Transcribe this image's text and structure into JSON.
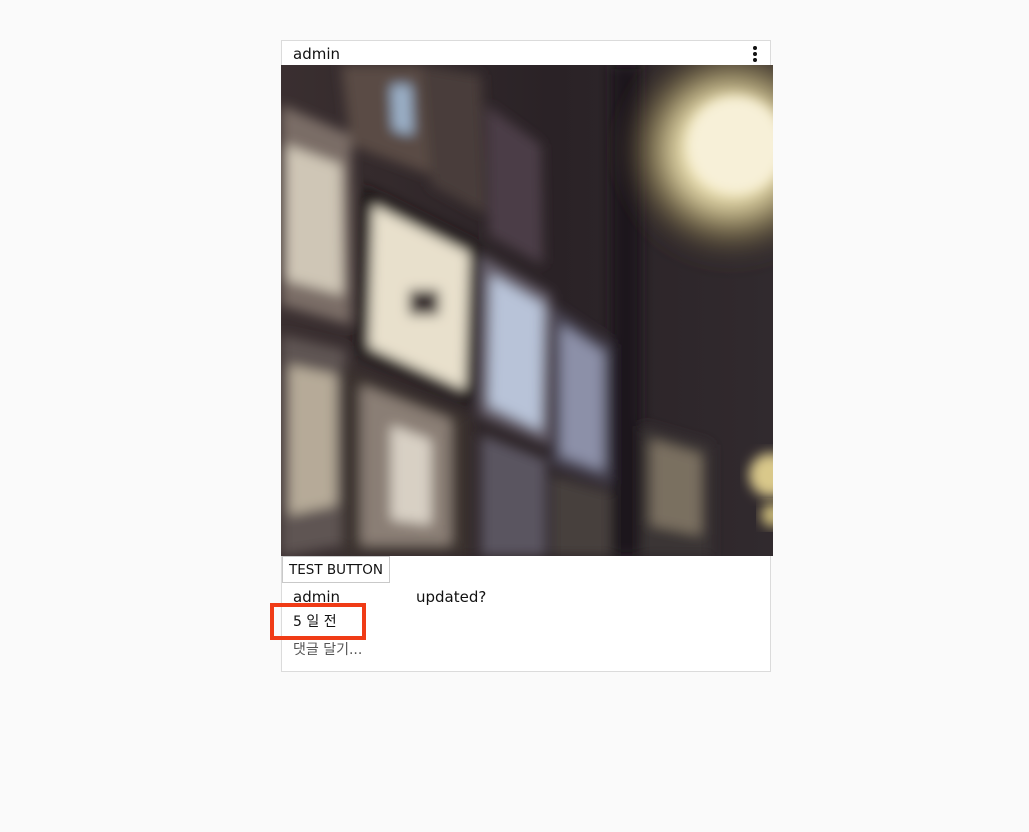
{
  "post": {
    "author": "admin",
    "more_icon": "more-vertical-icon",
    "image_alt": "blurred photo of a wall of framed pictures with a bright lamp",
    "test_button_label": "TEST BUTTON",
    "caption_author": "admin",
    "caption_text": "updated?",
    "timestamp": "5 일 전",
    "comment_placeholder": "댓글 달기..."
  },
  "colors": {
    "highlight": "#f03b16",
    "border": "#dbdbdb",
    "background": "#fafafa"
  }
}
